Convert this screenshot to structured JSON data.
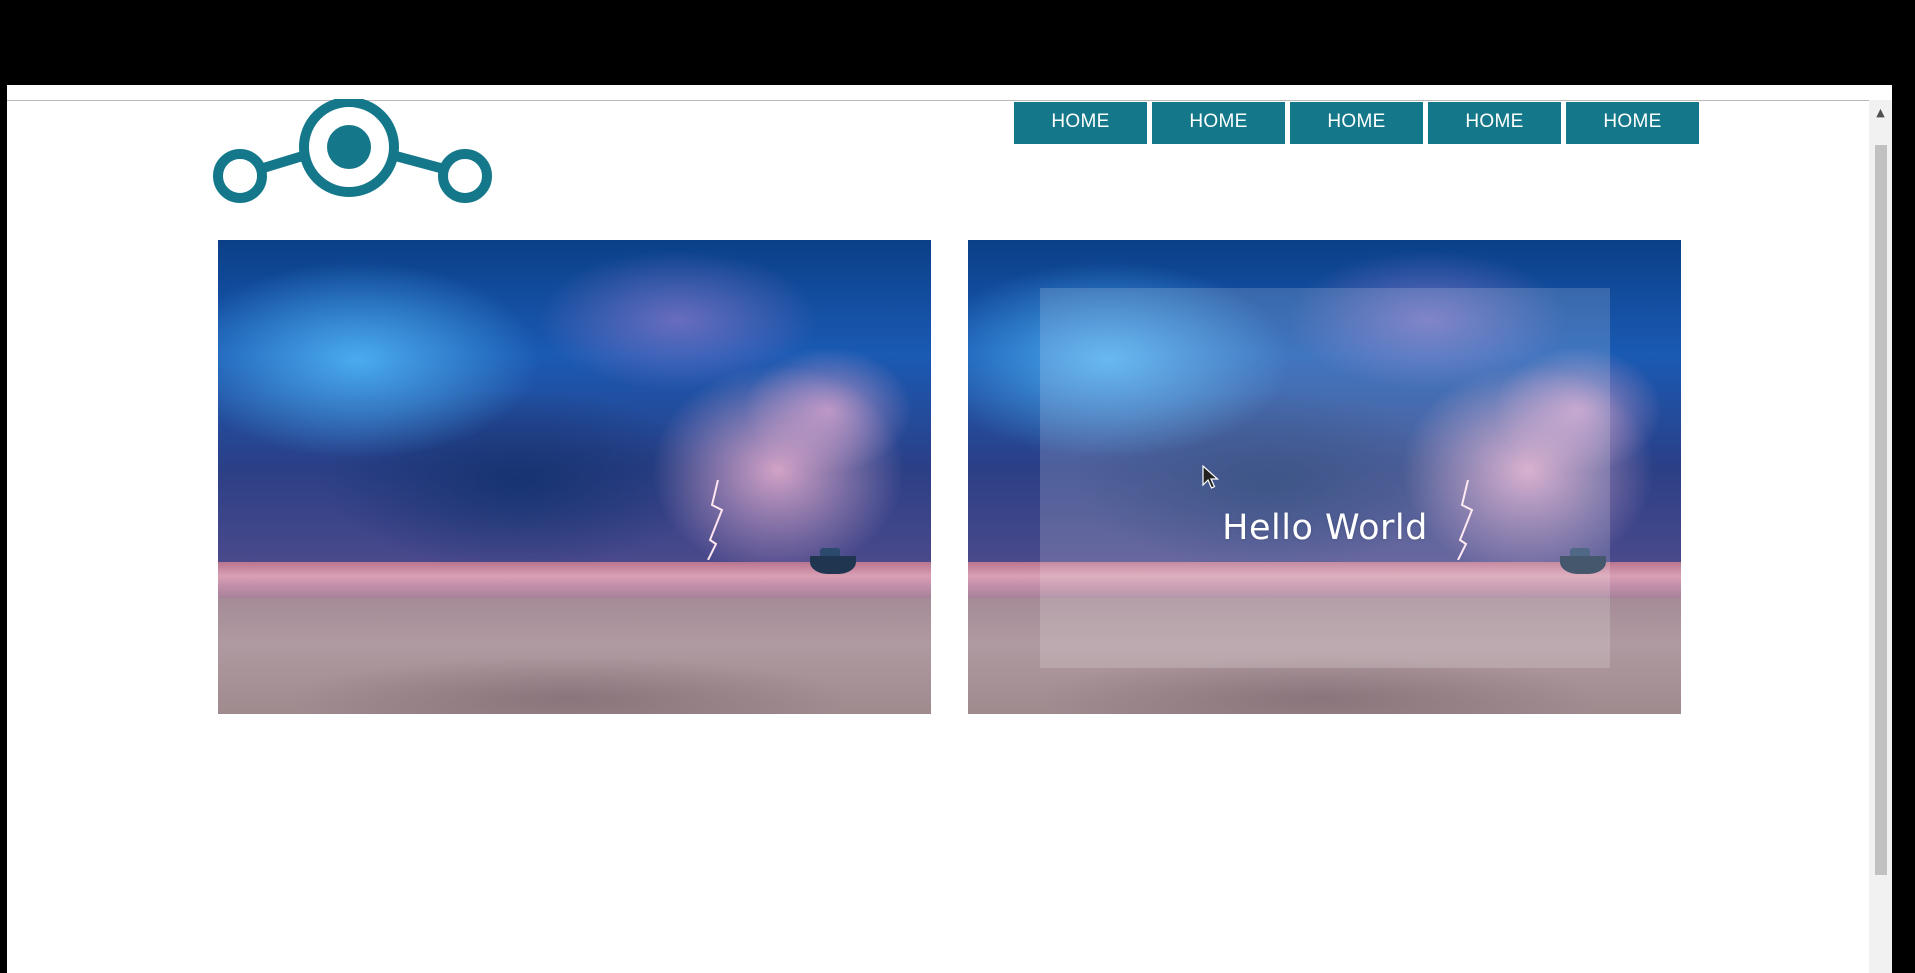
{
  "nav": {
    "items": [
      "HOME",
      "HOME",
      "HOME",
      "HOME",
      "HOME"
    ]
  },
  "gallery": {
    "overlay_text": "Hello World"
  },
  "colors": {
    "accent": "#15788a",
    "page_background": "#ffffff",
    "chrome_background": "#000000"
  },
  "icons": {
    "logo": "network-nodes-logo",
    "cursor": "mouse-pointer-icon",
    "scroll_up": "scroll-up-arrow-icon"
  }
}
